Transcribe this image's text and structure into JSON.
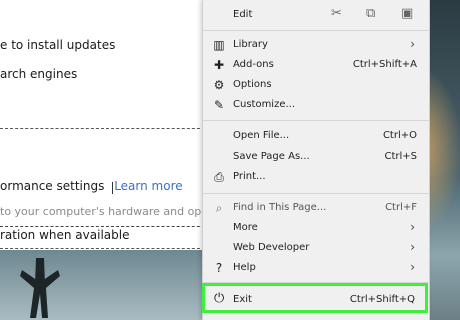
{
  "settings_page": {
    "line1": "e to install updates",
    "line2": "arch engines",
    "perf_label": "ormance settings",
    "learn_more": "Learn more",
    "hardware_text": "to your computer's hardware and opera",
    "accel_text": "ration when available"
  },
  "menu": {
    "edit": {
      "label": "Edit",
      "icons": [
        "cut-icon",
        "copy-icon",
        "paste-icon"
      ]
    },
    "group1": [
      {
        "label": "Library",
        "shortcut": "",
        "icon": "library-icon",
        "submenu": true
      },
      {
        "label": "Add-ons",
        "shortcut": "Ctrl+Shift+A",
        "icon": "puzzle-icon",
        "submenu": false
      },
      {
        "label": "Options",
        "shortcut": "",
        "icon": "gear-icon",
        "submenu": false
      },
      {
        "label": "Customize...",
        "shortcut": "",
        "icon": "brush-icon",
        "submenu": false
      }
    ],
    "group2": [
      {
        "label": "Open File...",
        "shortcut": "Ctrl+O",
        "icon": "",
        "submenu": false
      },
      {
        "label": "Save Page As...",
        "shortcut": "Ctrl+S",
        "icon": "",
        "submenu": false
      },
      {
        "label": "Print...",
        "shortcut": "",
        "icon": "printer-icon",
        "submenu": false
      }
    ],
    "group3": [
      {
        "label": "Find in This Page...",
        "shortcut": "Ctrl+F",
        "icon": "search-icon",
        "submenu": false
      },
      {
        "label": "More",
        "shortcut": "",
        "icon": "",
        "submenu": true
      },
      {
        "label": "Web Developer",
        "shortcut": "",
        "icon": "",
        "submenu": true
      },
      {
        "label": "Help",
        "shortcut": "",
        "icon": "help-icon",
        "submenu": true
      }
    ],
    "exit": {
      "label": "Exit",
      "shortcut": "Ctrl+Shift+Q",
      "icon": "power-icon"
    }
  },
  "colors": {
    "highlight": "#3ef03c",
    "link": "#3b6fc4",
    "menu_bg": "#f0f0f0"
  }
}
